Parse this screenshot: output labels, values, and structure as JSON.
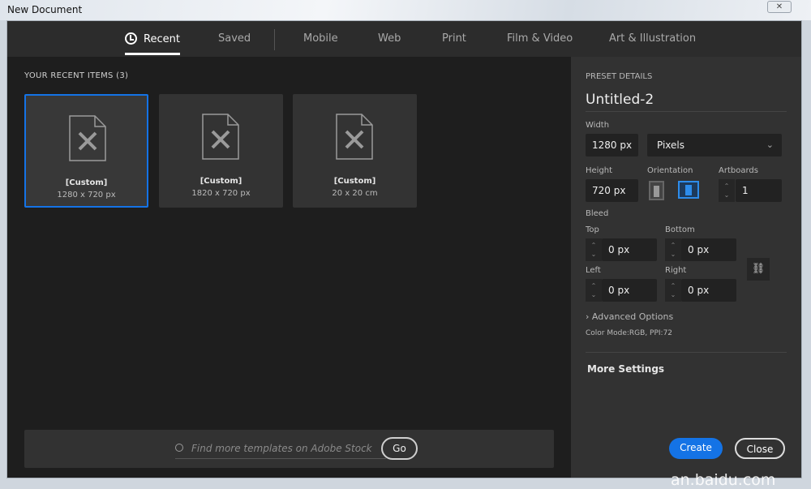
{
  "window": {
    "title": "New Document",
    "close_label": "✕"
  },
  "tabs": [
    {
      "label": "Recent",
      "active": true
    },
    {
      "label": "Saved"
    },
    {
      "label": "Mobile"
    },
    {
      "label": "Web"
    },
    {
      "label": "Print"
    },
    {
      "label": "Film & Video"
    },
    {
      "label": "Art & Illustration"
    }
  ],
  "recent": {
    "heading": "YOUR RECENT ITEMS",
    "count": "(3)",
    "items": [
      {
        "name": "[Custom]",
        "size": "1280 x 720 px",
        "selected": true
      },
      {
        "name": "[Custom]",
        "size": "1820 x 720 px"
      },
      {
        "name": "[Custom]",
        "size": "20 x 20 cm"
      }
    ]
  },
  "search": {
    "placeholder": "Find more templates on Adobe Stock",
    "go_label": "Go"
  },
  "preset": {
    "heading": "PRESET DETAILS",
    "name": "Untitled-2",
    "width_label": "Width",
    "width": "1280 px",
    "unit": "Pixels",
    "height_label": "Height",
    "height": "720 px",
    "orientation_label": "Orientation",
    "orientation": "landscape",
    "artboards_label": "Artboards",
    "artboards": "1",
    "bleed_label": "Bleed",
    "top_label": "Top",
    "top": "0 px",
    "bottom_label": "Bottom",
    "bottom": "0 px",
    "left_label": "Left",
    "left": "0 px",
    "right_label": "Right",
    "right": "0 px",
    "advanced_label": "Advanced Options",
    "color_mode": "Color Mode:RGB, PPI:72",
    "more_settings": "More Settings",
    "create_label": "Create",
    "close_label": "Close"
  },
  "watermark": "an.baidu.com",
  "colors": {
    "accent": "#1473e6"
  }
}
